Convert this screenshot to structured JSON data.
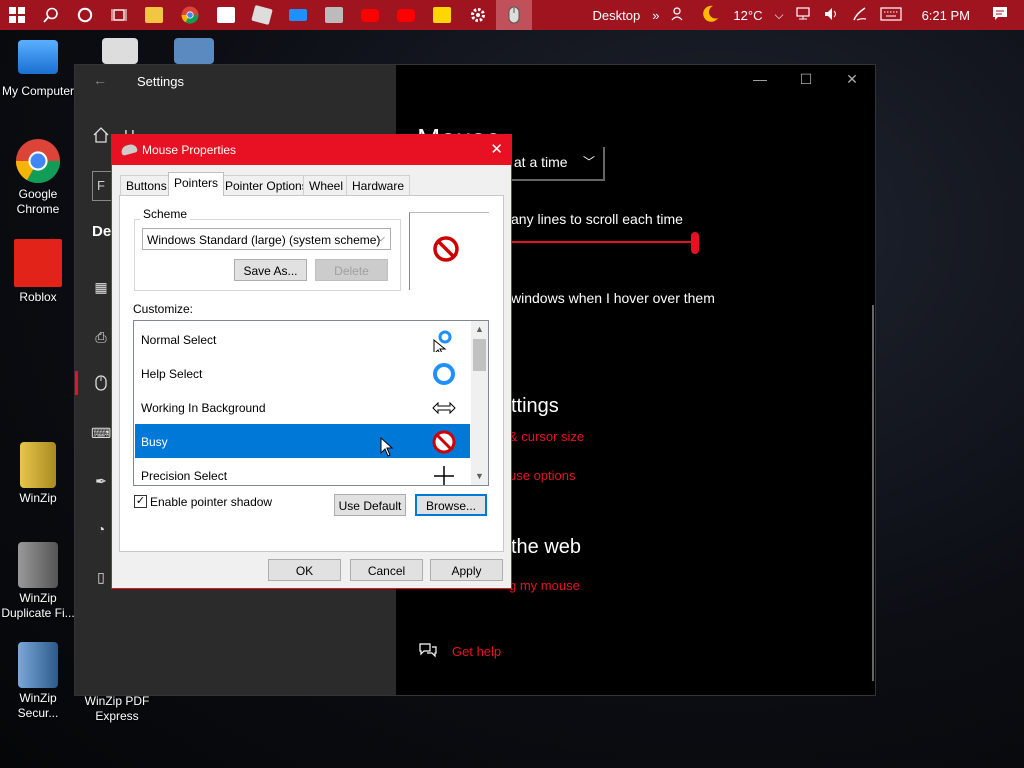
{
  "taskbar": {
    "desktop_label": "Desktop",
    "temperature": "12°C",
    "time": "6:21 PM",
    "apps": [
      "file-explorer-icon",
      "chrome-icon",
      "store-icon",
      "roblox-icon",
      "mail-icon",
      "photos-icon",
      "youtube-icon",
      "youtube-icon-2",
      "sticky-notes-icon",
      "settings-icon",
      "mouse-icon"
    ]
  },
  "desktop": {
    "icons": [
      {
        "label": "My Computer"
      },
      {
        "label": "Google Chrome"
      },
      {
        "label": "Roblox"
      },
      {
        "label": "WinZip"
      },
      {
        "label": "WinZip Duplicate Fi..."
      },
      {
        "label": "WinZip Secur..."
      },
      {
        "label": "WinZip PDF Express"
      }
    ]
  },
  "settings": {
    "title": "Settings",
    "home_label": "H",
    "search_char": "F",
    "section_label": "Dev",
    "page_title": "Mouse",
    "scroll_dropdown": "s at a time",
    "lines_to_scroll": "any lines to scroll each time",
    "hover_scroll": "windows when I hover over them",
    "related_heading": "ttings",
    "link_cursor_size": "& cursor size",
    "link_mouse_options": "use options",
    "web_heading": "the web",
    "link_web": "g my mouse",
    "get_help": "Get help"
  },
  "dialog": {
    "title": "Mouse Properties",
    "tabs": [
      "Buttons",
      "Pointers",
      "Pointer Options",
      "Wheel",
      "Hardware"
    ],
    "scheme_label": "Scheme",
    "scheme_value": "Windows Standard (large) (system scheme)",
    "save_as": "Save As...",
    "delete": "Delete",
    "customize_label": "Customize:",
    "cursors": [
      {
        "name": "Normal Select"
      },
      {
        "name": "Help Select"
      },
      {
        "name": "Working In Background"
      },
      {
        "name": "Busy"
      },
      {
        "name": "Precision Select"
      }
    ],
    "enable_shadow": "Enable pointer shadow",
    "use_default": "Use Default",
    "browse": "Browse...",
    "ok": "OK",
    "cancel": "Cancel",
    "apply": "Apply"
  },
  "colors": {
    "accent": "#e81123",
    "taskbar": "#a01420",
    "selection": "#0078d7"
  }
}
